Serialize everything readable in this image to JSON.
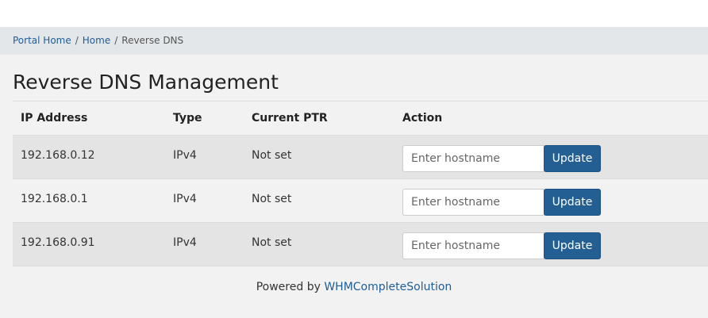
{
  "breadcrumb": {
    "items": [
      "Portal Home",
      "Home"
    ],
    "separator": "/",
    "current": "Reverse DNS"
  },
  "page": {
    "title": "Reverse DNS Management"
  },
  "table": {
    "columns": [
      "IP Address",
      "Type",
      "Current PTR",
      "Action"
    ],
    "rows": [
      {
        "ip": "192.168.0.12",
        "type": "IPv4",
        "ptr": "Not set",
        "placeholder": "Enter hostname",
        "button": "Update"
      },
      {
        "ip": "192.168.0.1",
        "type": "IPv4",
        "ptr": "Not set",
        "placeholder": "Enter hostname",
        "button": "Update"
      },
      {
        "ip": "192.168.0.91",
        "type": "IPv4",
        "ptr": "Not set",
        "placeholder": "Enter hostname",
        "button": "Update"
      }
    ]
  },
  "footer": {
    "prefix": "Powered by",
    "link_label": "WHMCompleteSolution"
  },
  "colors": {
    "link": "#1f5d96",
    "button": "#245f94",
    "breadcrumb_bg": "#e4e7ea",
    "page_bg": "#f2f2f2"
  }
}
